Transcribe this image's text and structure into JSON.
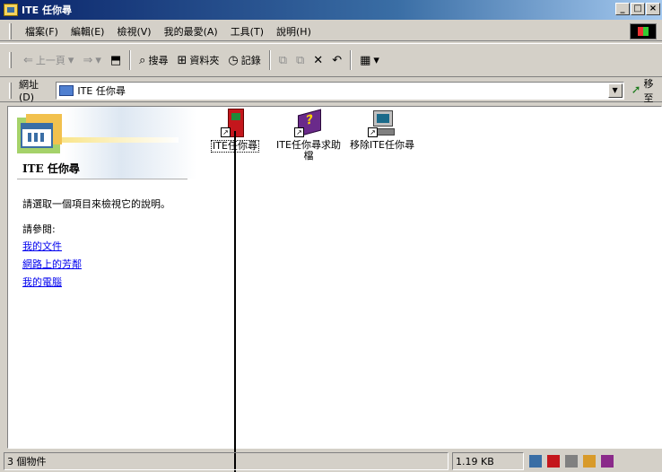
{
  "window": {
    "title": "ITE 任你尋",
    "buttons": {
      "minimize": "_",
      "maximize": "□",
      "close": "×"
    }
  },
  "menu": {
    "items": [
      "檔案(F)",
      "編輯(E)",
      "檢視(V)",
      "我的最愛(A)",
      "工具(T)",
      "說明(H)"
    ]
  },
  "toolbar": {
    "back": "上一頁",
    "forward": "",
    "up": "",
    "search": "搜尋",
    "folders": "資料夾",
    "history": "記錄"
  },
  "address": {
    "label": "網址(D)",
    "value": "ITE 任你尋",
    "go": "移至"
  },
  "left_pane": {
    "title": "ITE 任你尋",
    "description": "請選取一個項目來檢視它的說明。",
    "see_also": "請參閱:",
    "links": [
      "我的文件",
      "網路上的芳鄰",
      "我的電腦"
    ]
  },
  "files": [
    {
      "label": "ITE任你尋",
      "icon": "app-shortcut-icon"
    },
    {
      "label": "ITE任你尋求助檔",
      "icon": "help-book-icon"
    },
    {
      "label": "移除ITE任你尋",
      "icon": "uninstall-icon"
    }
  ],
  "status": {
    "objects": "3 個物件",
    "size": "1.19 KB"
  },
  "colors": {
    "titlebar_start": "#0a246a",
    "titlebar_end": "#a6caf0",
    "link": "#0000ee",
    "face": "#d4d0c8"
  }
}
